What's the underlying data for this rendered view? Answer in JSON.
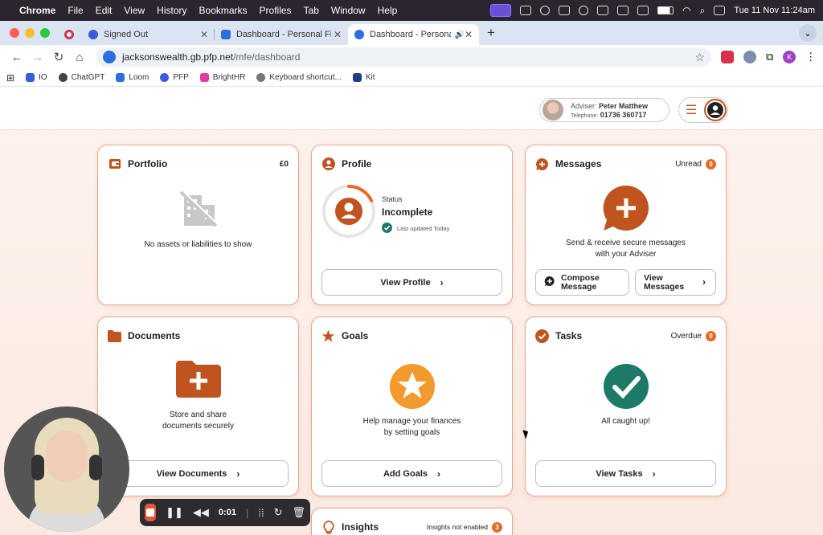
{
  "menubar": {
    "app": "Chrome",
    "items": [
      "File",
      "Edit",
      "View",
      "History",
      "Bookmarks",
      "Profiles",
      "Tab",
      "Window",
      "Help"
    ],
    "datetime": "Tue 11 Nov  11:24am"
  },
  "tabs": [
    {
      "label": "Signed Out"
    },
    {
      "label": "Dashboard - Personal Financ..."
    },
    {
      "label": "Dashboard - Personal Fin"
    }
  ],
  "toolbar": {
    "url_host": "jacksonswealth.gb.pfp.net",
    "url_path": "/mfe/dashboard",
    "profile_initial": "K"
  },
  "bookmarks": [
    "IO",
    "ChatGPT",
    "Loom",
    "PFP",
    "BrightHR",
    "Keyboard shortcut...",
    "Kit"
  ],
  "header": {
    "adviser_label": "Adviser:",
    "adviser_name": "Peter Matthew",
    "telephone_label": "Telephone:",
    "telephone": "01736 360717"
  },
  "cards": {
    "portfolio": {
      "title": "Portfolio",
      "value": "£0",
      "empty_text": "No assets or liabilities to show"
    },
    "profile": {
      "title": "Profile",
      "status_label": "Status",
      "status_value": "Incomplete",
      "updated": "Last updated Today",
      "button": "View Profile",
      "progress": 0.18
    },
    "messages": {
      "title": "Messages",
      "meta_label": "Unread",
      "count": "0",
      "text1": "Send & receive secure messages",
      "text2": "with your Adviser",
      "compose_line1": "Compose",
      "compose_line2": "Message",
      "view_line1": "View",
      "view_line2": "Messages"
    },
    "documents": {
      "title": "Documents",
      "text1": "Store and share",
      "text2": "documents securely",
      "button": "View Documents"
    },
    "goals": {
      "title": "Goals",
      "text1": "Help manage your finances",
      "text2": "by setting goals",
      "button": "Add Goals"
    },
    "tasks": {
      "title": "Tasks",
      "meta_label": "Overdue",
      "count": "0",
      "text": "All caught up!",
      "button": "View Tasks"
    },
    "insights": {
      "title": "Insights",
      "meta_label": "Insights not enabled",
      "count": "3"
    }
  },
  "recorder": {
    "time": "0:01"
  },
  "colors": {
    "accent": "#c0541f",
    "card_border": "#eaa68a",
    "goals": "#f29a2e",
    "tasks": "#1d7a68",
    "badge": "#e56a2a"
  }
}
